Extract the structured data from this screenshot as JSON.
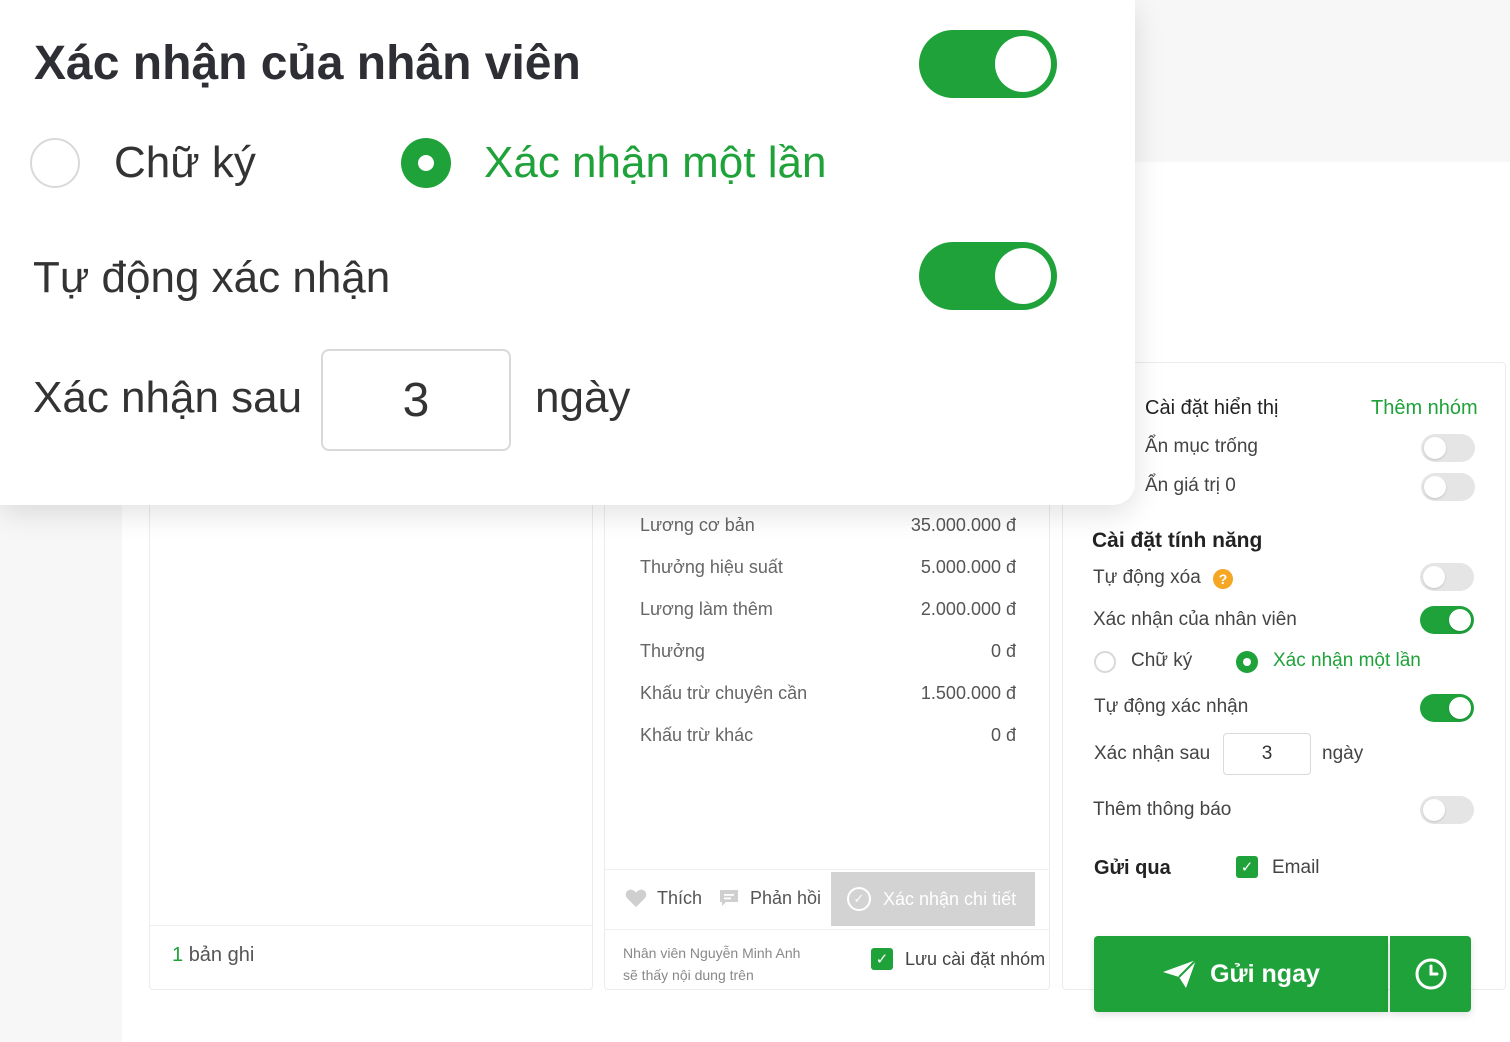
{
  "zoom": {
    "employee_confirm_label": "Xác nhận của nhân viên",
    "signature_label": "Chữ ký",
    "one_time_label": "Xác nhận một lần",
    "auto_confirm_label": "Tự động xác nhận",
    "confirm_after_label": "Xác nhận sau",
    "confirm_after_value": "3",
    "days_label": "ngày"
  },
  "list": {
    "record_count": "1",
    "record_suffix": "bản ghi"
  },
  "payslip": {
    "rows": [
      {
        "label": "Lương cơ bản",
        "value": "35.000.000 đ"
      },
      {
        "label": "Thưởng hiệu suất",
        "value": "5.000.000 đ"
      },
      {
        "label": "Lương làm thêm",
        "value": "2.000.000 đ"
      },
      {
        "label": "Thưởng",
        "value": "0 đ"
      },
      {
        "label": "Khấu trừ chuyên cần",
        "value": "1.500.000 đ"
      },
      {
        "label": "Khấu trừ khác",
        "value": "0 đ"
      }
    ],
    "like_label": "Thích",
    "reply_label": "Phản hồi",
    "confirm_detail_label": "Xác nhận chi tiết",
    "notice_line1": "Nhân viên Nguyễn Minh Anh",
    "notice_line2": "sẽ thấy nội dung trên",
    "save_group_label": "Lưu cài đặt nhóm"
  },
  "settings": {
    "display_heading": "Cài đặt hiển thị",
    "add_group_link": "Thêm nhóm",
    "hide_empty_label": "Ẩn mục trống",
    "hide_zero_label": "Ẩn giá trị 0",
    "feature_heading": "Cài đặt tính năng",
    "auto_delete_label": "Tự động xóa",
    "help_mark": "?",
    "employee_confirm_label": "Xác nhận của nhân viên",
    "signature_label": "Chữ ký",
    "one_time_label": "Xác nhận một lần",
    "auto_confirm_label": "Tự động xác nhận",
    "confirm_after_label": "Xác nhận sau",
    "confirm_after_value": "3",
    "days_label": "ngày",
    "add_notice_label": "Thêm thông báo",
    "send_via_label": "Gửi qua",
    "email_label": "Email",
    "toggles": {
      "hide_empty": false,
      "hide_zero": false,
      "auto_delete": false,
      "employee_confirm": true,
      "auto_confirm": true,
      "add_notice": false
    }
  },
  "actions": {
    "send_now_label": "Gửi ngay"
  },
  "colors": {
    "accent": "#1fa23a",
    "warning": "#f5a623"
  }
}
